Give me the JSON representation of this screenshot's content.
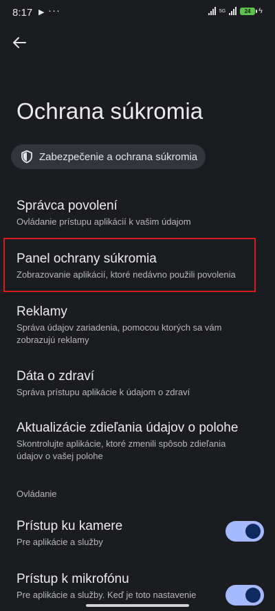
{
  "status_bar": {
    "time": "8:17",
    "dots": "···",
    "network": "5G",
    "battery": "24"
  },
  "page": {
    "title": "Ochrana súkromia"
  },
  "chip": {
    "label": "Zabezpečenie a ochrana súkromia"
  },
  "items": [
    {
      "title": "Správca povolení",
      "subtitle": "Ovládanie prístupu aplikácií k vašim údajom"
    },
    {
      "title": "Panel ochrany súkromia",
      "subtitle": "Zobrazovanie aplikácií, ktoré nedávno použili povolenia"
    },
    {
      "title": "Reklamy",
      "subtitle": "Správa údajov zariadenia, pomocou ktorých sa vám zobrazujú reklamy"
    },
    {
      "title": "Dáta o zdraví",
      "subtitle": "Správa prístupu aplikácie k údajom o zdraví"
    },
    {
      "title": "Aktualizácie zdieľania údajov o polohe",
      "subtitle": "Skontrolujte aplikácie, ktoré zmenili spôsob zdieľania údajov o vašej polohe"
    }
  ],
  "section": {
    "label": "Ovládanie"
  },
  "toggles": [
    {
      "title": "Prístup ku kamere",
      "subtitle": "Pre aplikácie a služby",
      "enabled": true
    },
    {
      "title": "Prístup k mikrofónu",
      "subtitle": "Pre aplikácie a služby. Keď je toto nastavenie",
      "enabled": true
    }
  ],
  "colors": {
    "background": "#1b1c20",
    "highlight": "#d81b20",
    "toggle_track": "#a6b9ff",
    "toggle_knob": "#0f2a5e"
  }
}
